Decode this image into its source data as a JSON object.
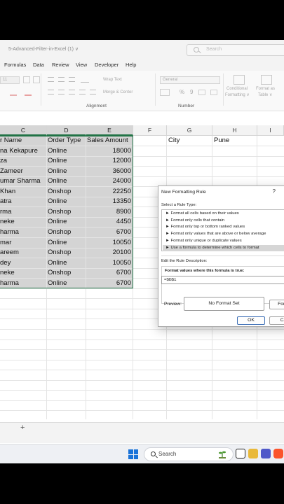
{
  "window": {
    "doc_title": "5-Advanced-Filter-in-Excel (1)  ∨",
    "search_placeholder": "Search"
  },
  "menu": {
    "tabs": [
      "Formulas",
      "Data",
      "Review",
      "View",
      "Developer",
      "Help"
    ]
  },
  "ribbon": {
    "font_size": "11",
    "wrap_text": "Wrap Text",
    "merge_center": "Merge & Center",
    "number_format": "General",
    "percent": "%",
    "comma": "9",
    "conditional_formatting": [
      "Conditional",
      "Formatting ∨"
    ],
    "format_as_table": [
      "Format as",
      "Table ∨"
    ],
    "groups": [
      "Alignment",
      "Number"
    ]
  },
  "sheet": {
    "columns": [
      "C",
      "D",
      "E",
      "F",
      "G",
      "H",
      "I"
    ],
    "headers": [
      "r Name",
      "Order Type",
      "Sales Amount"
    ],
    "rows": [
      [
        "na Kekapure",
        "Online",
        "18000"
      ],
      [
        "za",
        "Online",
        "12000"
      ],
      [
        "Zameer",
        "Online",
        "36000"
      ],
      [
        "umar Sharma",
        "Online",
        "24000"
      ],
      [
        "Khan",
        "Onshop",
        "22250"
      ],
      [
        "atra",
        "Online",
        "13350"
      ],
      [
        "rma",
        "Onshop",
        "8900"
      ],
      [
        "neke",
        "Online",
        "4450"
      ],
      [
        "harma",
        "Onshop",
        "6700"
      ],
      [
        "mar",
        "Online",
        "10050"
      ],
      [
        "areem",
        "Onshop",
        "20100"
      ],
      [
        "dey",
        "Online",
        "10050"
      ],
      [
        "neke",
        "Onshop",
        "6700"
      ],
      [
        "harma",
        "Online",
        "6700"
      ]
    ],
    "criteria_label": "City",
    "criteria_value": "Pune"
  },
  "sheet_tabs": {
    "add_sheet": "+"
  },
  "taskbar": {
    "search_text": "Search"
  },
  "dialog": {
    "title": "New Formatting Rule",
    "help": "?",
    "select_rule_type_label": "Select a Rule Type:",
    "rule_types": [
      "► Format all cells based on their values",
      "► Format only cells that contain",
      "► Format only top or bottom ranked values",
      "► Format only values that are above or below average",
      "► Format only unique or duplicate values",
      "► Use a formula to determine which cells to format"
    ],
    "selected_rule_index": 5,
    "edit_description_label": "Edit the Rule Description:",
    "formula_label": "Format values where this formula is true:",
    "formula_value": "=$B$1",
    "preview_label": "Preview:",
    "preview_text": "No Format Set",
    "format_button": "Form",
    "ok_button": "OK",
    "cancel_button": "Ca"
  },
  "colors": {
    "excel_green": "#217346",
    "selection_fill": "#d4d4d4",
    "windows_blue": "#1a73d8"
  }
}
